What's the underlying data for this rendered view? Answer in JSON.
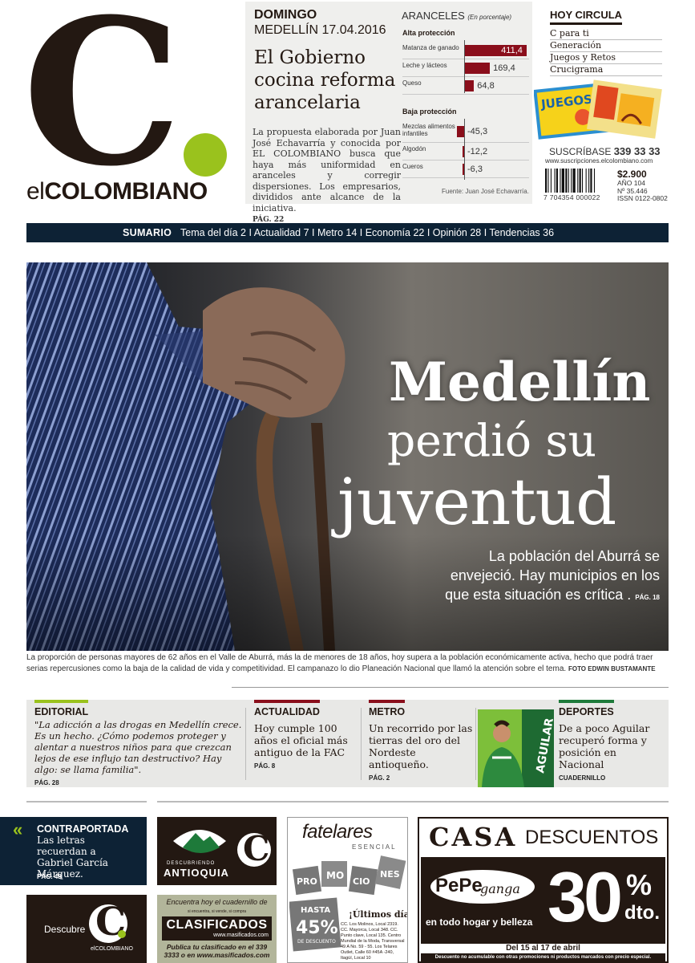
{
  "masthead": {
    "logo_letter": "C",
    "logo_dot": ".",
    "wordmark_prefix": "el",
    "wordmark_name": "COLOMBIANO"
  },
  "edition": {
    "day": "DOMINGO",
    "date": "MEDELLÍN 17.04.2016"
  },
  "lead_story": {
    "headline": "El Gobierno cocina reforma arancelaria",
    "lede": "La propuesta elaborada por Juan José Echavarría y conocida por EL COLOMBIANO busca que haya más uniformidad en aranceles y corregir dispersiones. Los empresarios, divididos ante alcance de la iniciativa.",
    "page_ref": "PÁG. 22"
  },
  "chart_data": {
    "type": "bar",
    "title": "ARANCELES",
    "subtitle": "(En porcentaje)",
    "groups": [
      {
        "name": "Alta protección",
        "categories": [
          "Matanza de ganado",
          "Leche y lácteos",
          "Queso"
        ],
        "values": [
          411.4,
          169.4,
          64.8
        ],
        "labels": [
          "411,4",
          "169,4",
          "64,8"
        ]
      },
      {
        "name": "Baja protección",
        "categories": [
          "Mezclas alimentos infantiles",
          "Algodón",
          "Cueros"
        ],
        "values": [
          -45.3,
          -12.2,
          -6.3
        ],
        "labels": [
          "-45,3",
          "-12,2",
          "-6,3"
        ]
      }
    ],
    "bar_color": "#8a0e1b",
    "source": "Fuente: Juan José Echavarría."
  },
  "hoy_circula": {
    "label": "HOY CIRCULA",
    "items": [
      "C para ti",
      "Generación",
      "Juegos y Retos",
      "Crucigrama"
    ]
  },
  "subscription": {
    "label": "SUSCRÍBASE",
    "phone": "339 33 33",
    "url": "www.suscripciones.elcolombiano.com"
  },
  "issue": {
    "price": "$2.900",
    "year": "AÑO 104",
    "number": "Nº 35.446",
    "issn": "ISSN 0122-0802",
    "barcode": "7 704354 000022"
  },
  "sumario": {
    "label": "SUMARIO",
    "items": "Tema del día 2  I  Actualidad 7  I  Metro 14  I  Economía 22  I  Opinión 28  I  Tendencias 36"
  },
  "hero": {
    "line1": "Medellín",
    "line2": "perdió su",
    "line3": "juventud",
    "deck": "La población del Aburrá se envejeció. Hay municipios en los que esta situación es crítica .",
    "page_ref": "PÁG. 18",
    "caption": "La proporción de personas mayores de 62 años en el Valle de Aburrá, más la de menores de 18 años, hoy supera a la población económicamente activa, hecho que podrá traer serias repercusiones como la baja de la calidad de vida y competitividad. El campanazo lo dio Planeación Nacional que llamó la atención sobre el tema.",
    "photo_credit": "FOTO EDWIN BUSTAMANTE"
  },
  "sections": [
    {
      "label": "EDITORIAL",
      "text": "\"La adicción a las drogas en Medellín crece. Es un hecho. ¿Cómo podemos proteger y alentar a nuestros niños para que crezcan lejos de ese influjo tan destructivo? Hay algo: se llama familia\".",
      "ref": "PÁG. 28",
      "color": "#9ac21d"
    },
    {
      "label": "ACTUALIDAD",
      "text": "Hoy cumple 100 años el oficial más antiguo de la FAC",
      "ref": "PÁG. 8",
      "color": "#8a0e1b"
    },
    {
      "label": "METRO",
      "text": "Un recorrido por las tierras del oro del Nordeste antioqueño.",
      "ref": "PÁG. 2",
      "color": "#8a0e1b"
    },
    {
      "label": "DEPORTES",
      "text": "De a poco Aguilar recuperó forma y posición en Nacional",
      "ref": "CUADERNILLO",
      "color": "#1e7a3a"
    }
  ],
  "contraportada": {
    "label": "CONTRAPORTADA",
    "text": "Las letras recuerdan a Gabriel García Márquez.",
    "ref": "PÁG. 48"
  },
  "ads": {
    "descubre": "Descubre",
    "descubre_brand": "elCOLOMBIANO",
    "antioquia_top": "DESCUBRIENDO",
    "antioquia_name": "ANTIOQUIA",
    "clasif_top": "Encuentra hoy el cuadernillo de",
    "clasif_small": "si encuentra, si vende, si compra",
    "clasif_name": "CLASIFICADOS",
    "clasif_url": "www.masificados.com",
    "clasif_bottom": "Publica tu clasificado en el 339 3333 o en www.masificados.com",
    "fatelares_brand": "fatelares",
    "fatelares_sub": "ESENCIAL",
    "promo_letters": [
      "PRO",
      "MO",
      "CIO",
      "NES"
    ],
    "hasta": "HASTA",
    "discount": "45%",
    "discount_sub": "DE DESCUENTO",
    "ultimos": "¡Últimos días!",
    "stores": "CC. Los Molinos, Local 2319. CC. Mayorca, Local 348. CC. Punto clave, Local 135. Centro Mundial de la Moda, Transversal 49 A No. 59 - 55. Los Telares Outlet, Calle 60 #45A -240, Itagüí, Local 10",
    "casa_word": "CASA",
    "casa_desc": "DESCUENTOS",
    "pepe": "PePe",
    "ganga": "ganga",
    "todo": "en todo hogar y belleza",
    "pct": "30",
    "pct_sign": "%",
    "dto": "dto.",
    "dates": "Del 15 al 17 de abril",
    "fine": "Descuento no acumulable con otras promociones ni productos marcados con precio especial."
  },
  "cover_thumbs": {
    "juegos": "JUEGOS"
  },
  "sports_photo": {
    "jersey_text": "AGUILAR"
  }
}
